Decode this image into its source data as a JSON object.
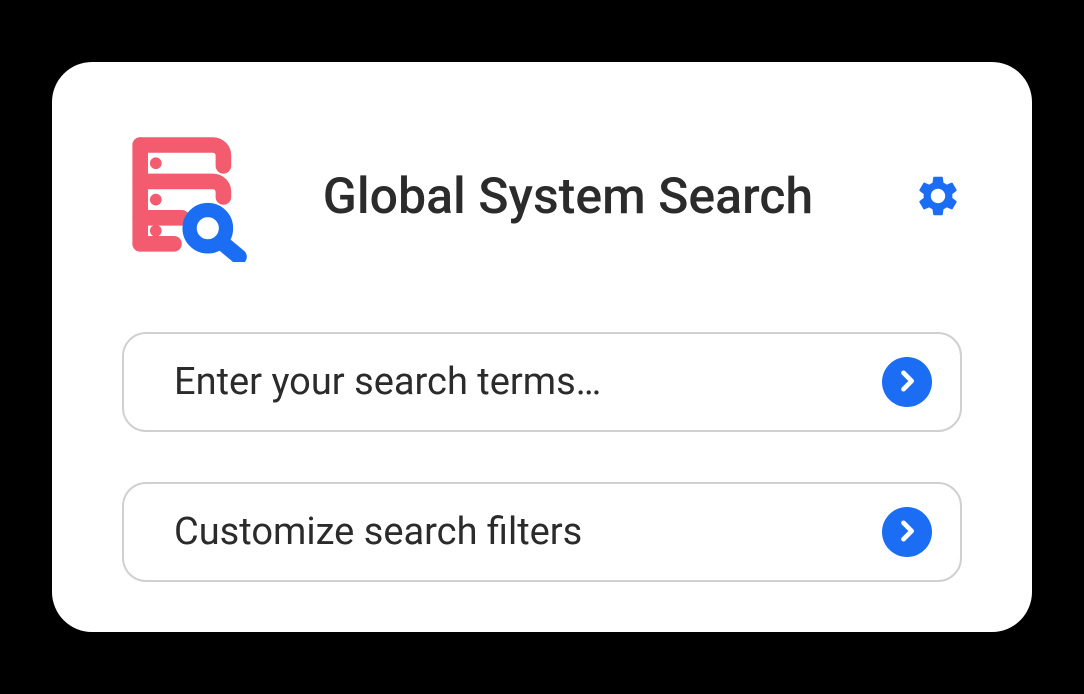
{
  "header": {
    "title": "Global System Search"
  },
  "search": {
    "placeholder": "Enter your search terms…",
    "value": ""
  },
  "filters": {
    "label": "Customize search filters"
  },
  "colors": {
    "accent_red": "#f25c6e",
    "accent_blue": "#1b6ef3",
    "text": "#2b2b2b",
    "border": "#d0d0d0"
  },
  "icons": {
    "logo": "database-search-icon",
    "settings": "gear-icon",
    "submit": "chevron-right-icon"
  }
}
